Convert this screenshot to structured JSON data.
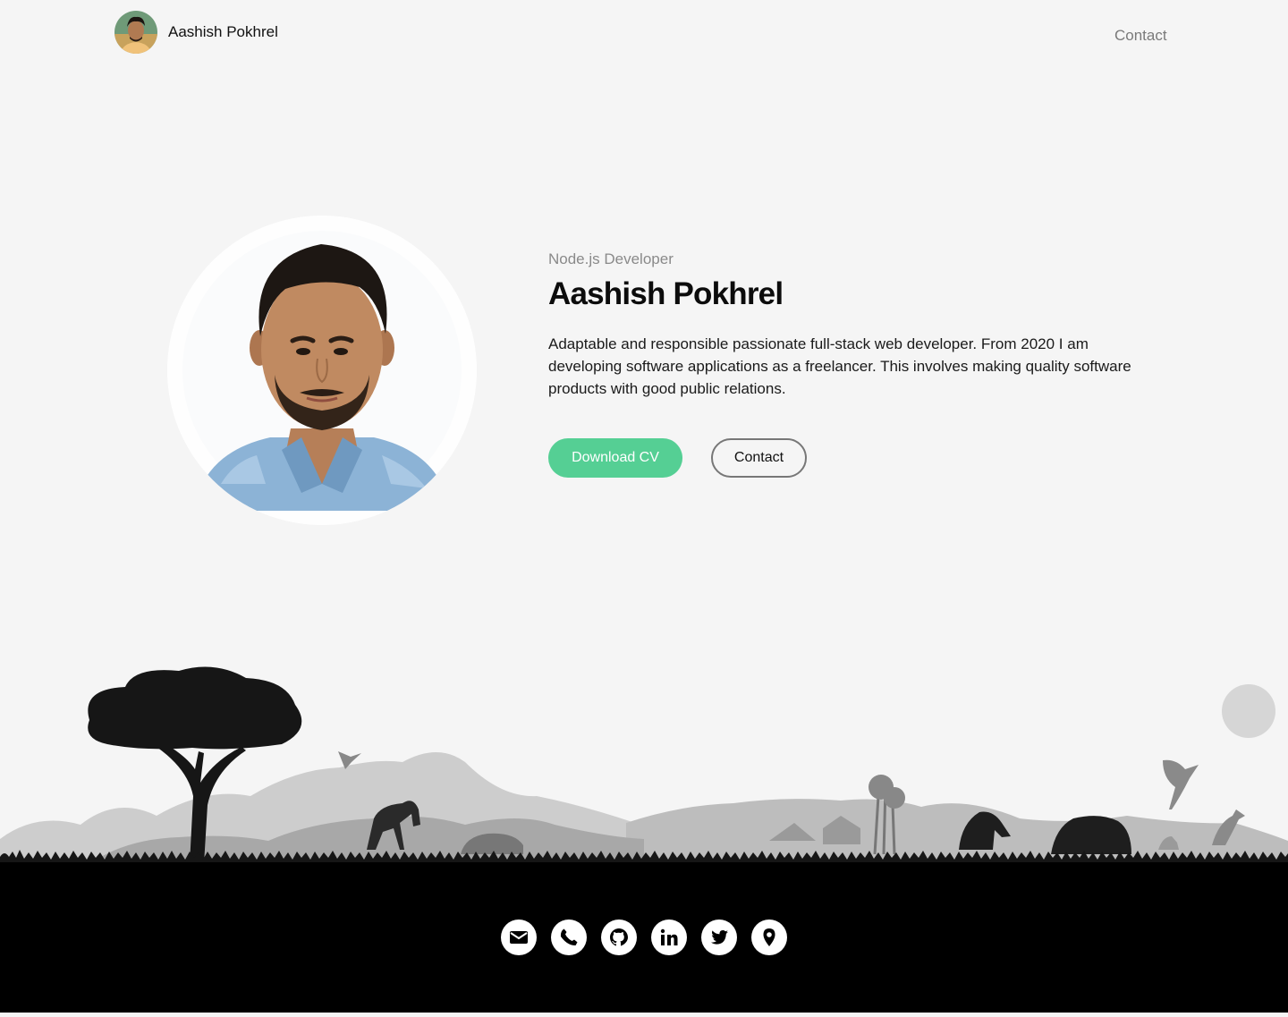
{
  "header": {
    "brand_name": "Aashish Pokhrel",
    "nav_contact": "Contact"
  },
  "hero": {
    "role": "Node.js Developer",
    "name": "Aashish Pokhrel",
    "description": "Adaptable and responsible passionate full-stack web developer. From 2020 I am developing software applications as a freelancer. This involves making quality software products with good public relations.",
    "download_cv": "Download CV",
    "contact": "Contact"
  },
  "colors": {
    "accent": "#55cf94",
    "background": "#f5f5f5",
    "footer": "#000000"
  },
  "footer": {
    "socials": [
      "mail-icon",
      "phone-icon",
      "github-icon",
      "linkedin-icon",
      "twitter-icon",
      "location-pin-icon"
    ]
  }
}
